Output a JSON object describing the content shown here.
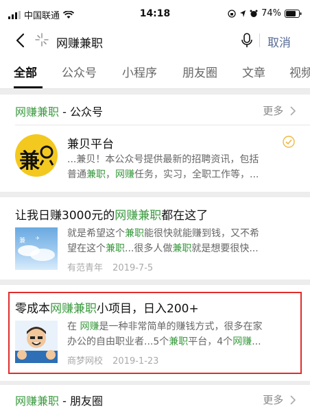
{
  "status": {
    "carrier": "中国联通",
    "time": "14:18",
    "battery": "74%"
  },
  "search": {
    "query": "网赚兼职",
    "cancel_label": "取消"
  },
  "tabs": [
    "全部",
    "公众号",
    "小程序",
    "朋友圈",
    "文章",
    "视频"
  ],
  "section_official": {
    "keyword": "网赚兼职",
    "suffix": " - 公众号",
    "more_label": "更多"
  },
  "account": {
    "logo_text": "兼",
    "name": "兼贝平台",
    "desc_line1": "...兼贝！本公众号提供最新的招聘资讯，包括",
    "desc_line2_a": "普通",
    "desc_line2_b": "兼职",
    "desc_line2_c": "，",
    "desc_line2_d": "网赚",
    "desc_line2_e": "任务，实习，全职工作等，..."
  },
  "article1": {
    "title_a": "让我日赚3000元的",
    "title_b": "网赚兼职",
    "title_c": "都在这了",
    "line1_a": "就是希望这个",
    "line1_b": "兼职",
    "line1_c": "能很快就能赚到钱，又不希",
    "line2_a": "望在这个",
    "line2_b": "兼职",
    "line2_c": "...很多人做",
    "line2_d": "兼职",
    "line2_e": "就是想要很快...",
    "source": "有范青年",
    "date": "2019-7-5"
  },
  "article2": {
    "title_a": "零成本",
    "title_b": "网赚兼职",
    "title_c": "小项目，日入200+",
    "line1_a": "在 ",
    "line1_b": "网赚",
    "line1_c": "是一种非常简单的赚钱方式，很多在家",
    "line2_a": "办公的自由职业者...5个",
    "line2_b": "兼职",
    "line2_c": "平台，4个",
    "line2_d": "网赚",
    "line2_e": "...",
    "source": "商梦网校",
    "date": "2019-1-23"
  },
  "section_moments": {
    "keyword": "网赚兼职",
    "suffix": " - 朋友圈",
    "more_label": "更多"
  },
  "colors": {
    "accent": "#3a9a3f",
    "link": "#576b95",
    "highlight_border": "#e02b2b",
    "logo_bg": "#f3c81f"
  }
}
